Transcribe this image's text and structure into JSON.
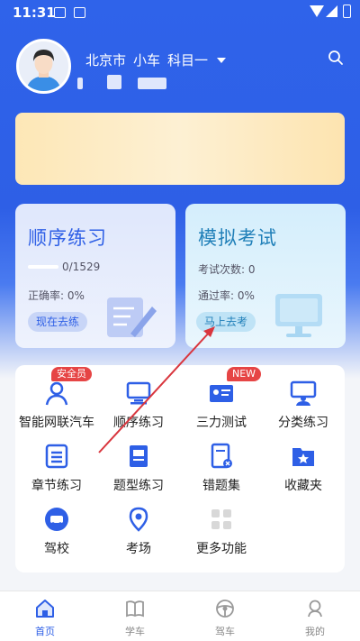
{
  "status_bar": {
    "time": "11:31"
  },
  "header": {
    "city": "北京市",
    "vehicle": "小车",
    "subject": "科目一"
  },
  "practice_card": {
    "title": "顺序练习",
    "progress": "0/1529",
    "progress_value": 0,
    "accuracy_label": "正确率: 0%",
    "button_label": "现在去练"
  },
  "exam_card": {
    "title": "模拟考试",
    "exam_count": "考试次数: 0",
    "pass_rate": "通过率: 0%",
    "button_label": "马上去考"
  },
  "grid": [
    {
      "label": "智能网联汽车",
      "badge": "安全员",
      "icon": "person-icon"
    },
    {
      "label": "顺序练习",
      "badge": "",
      "icon": "monitor-icon"
    },
    {
      "label": "三力测试",
      "badge": "NEW",
      "icon": "id-card-icon"
    },
    {
      "label": "分类练习",
      "badge": "",
      "icon": "classroom-icon"
    },
    {
      "label": "章节练习",
      "badge": "",
      "icon": "list-doc-icon"
    },
    {
      "label": "题型练习",
      "badge": "",
      "icon": "doc-icon"
    },
    {
      "label": "错题集",
      "badge": "",
      "icon": "wrong-book-icon"
    },
    {
      "label": "收藏夹",
      "badge": "",
      "icon": "star-folder-icon"
    },
    {
      "label": "驾校",
      "badge": "",
      "icon": "car-icon"
    },
    {
      "label": "考场",
      "badge": "",
      "icon": "location-icon"
    },
    {
      "label": "更多功能",
      "badge": "",
      "icon": "more-grid-icon"
    }
  ],
  "bottom_nav": [
    {
      "label": "首页",
      "active": true,
      "icon": "home-icon"
    },
    {
      "label": "学车",
      "active": false,
      "icon": "book-icon"
    },
    {
      "label": "驾车",
      "active": false,
      "icon": "steering-wheel-icon"
    },
    {
      "label": "我的",
      "active": false,
      "icon": "user-icon"
    }
  ],
  "colors": {
    "primary": "#2e5fe6",
    "badge_red": "#e64545",
    "annotation_arrow": "#d9363e"
  }
}
